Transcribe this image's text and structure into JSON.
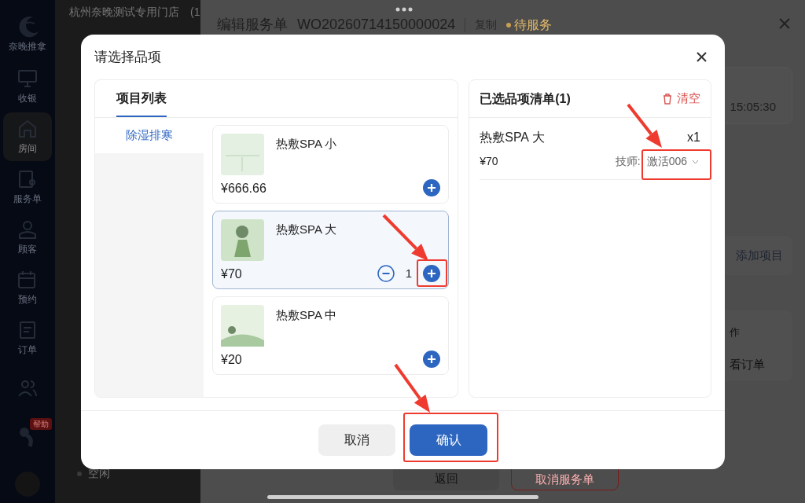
{
  "background": {
    "store_name": "杭州奈晚测试专用门店　(1",
    "sidebar": {
      "logo_text": "奈晚推拿",
      "items": [
        {
          "label": "收银",
          "selected": false
        },
        {
          "label": "房间",
          "selected": true
        },
        {
          "label": "服务单",
          "selected": false
        },
        {
          "label": "顾客",
          "selected": false
        },
        {
          "label": "预约",
          "selected": false
        },
        {
          "label": "订单",
          "selected": false
        },
        {
          "selected": false
        }
      ],
      "help_badge": "帮助"
    },
    "room_status": "空闲"
  },
  "drawer": {
    "title": "编辑服务单",
    "order_no": "WO20260714150000024",
    "copy_link": "复制",
    "status": "待服务",
    "time": "15:05:30",
    "add_item_button": "添加项目",
    "section_label": "作",
    "view_order_link": "看订单",
    "back_button": "返回",
    "cancel_order_button": "取消服务单"
  },
  "modal": {
    "title": "请选择品项",
    "tabs": [
      {
        "label": "项目列表",
        "selected": true
      }
    ],
    "categories": [
      {
        "label": "除湿排寒",
        "selected": true
      }
    ],
    "products": [
      {
        "name": "热敷SPA 小",
        "price": "¥666.66",
        "selected": false
      },
      {
        "name": "热敷SPA 大",
        "price": "¥70",
        "selected": true,
        "quantity": "1"
      },
      {
        "name": "热敷SPA 中",
        "price": "¥20",
        "selected": false
      }
    ],
    "selected_list": {
      "title": "已选品项清单(1)",
      "clear_button": "清空",
      "items": [
        {
          "name": "热敷SPA 大",
          "quantity": "x1",
          "price": "¥70",
          "technician_label": "技师:",
          "technician": "激活006"
        }
      ]
    },
    "cancel_button": "取消",
    "confirm_button": "确认"
  }
}
